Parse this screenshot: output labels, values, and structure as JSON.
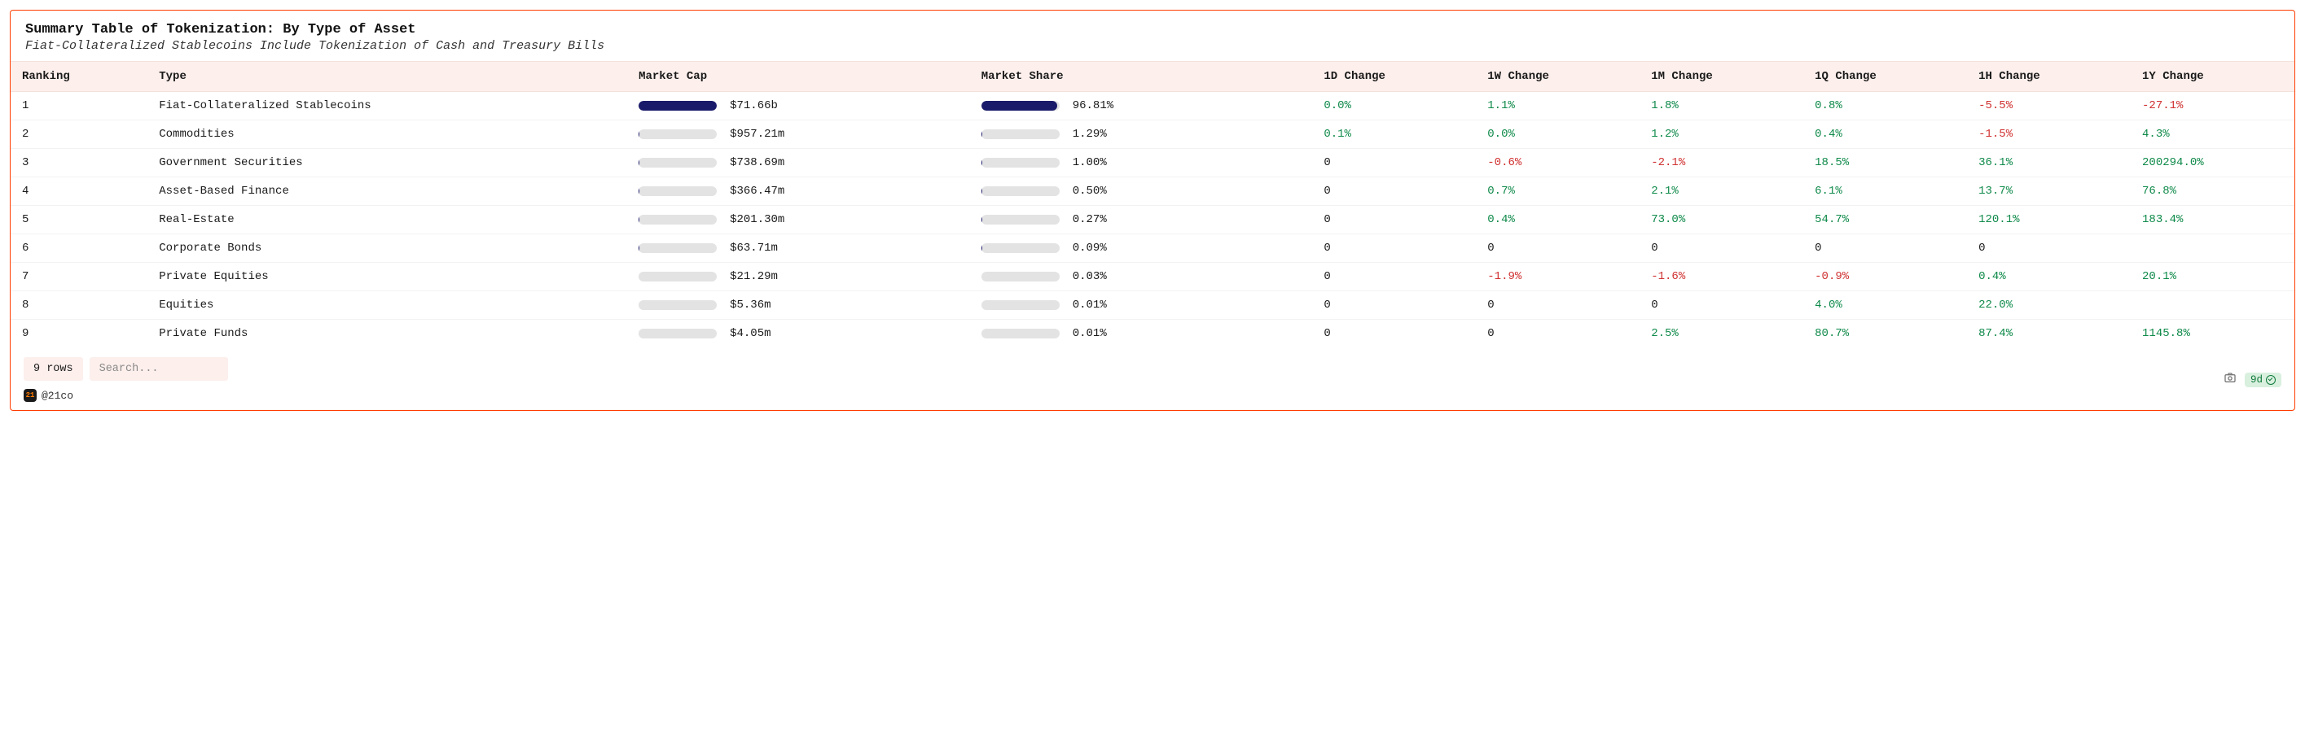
{
  "header": {
    "title": "Summary Table of Tokenization: By Type of Asset",
    "subtitle": "Fiat-Collateralized Stablecoins Include Tokenization of Cash and Treasury Bills"
  },
  "columns": {
    "ranking": "Ranking",
    "type": "Type",
    "market_cap": "Market Cap",
    "market_share": "Market Share",
    "d1": "1D Change",
    "w1": "1W Change",
    "m1": "1M Change",
    "q1": "1Q Change",
    "h1": "1H Change",
    "y1": "1Y Change"
  },
  "rows": [
    {
      "rank": "1",
      "type": "Fiat-Collateralized Stablecoins",
      "mcap": "$71.66b",
      "mcap_pct": 100,
      "mshare": "96.81%",
      "mshare_pct": 96.81,
      "d1": {
        "v": "0.0%",
        "c": "pos"
      },
      "w1": {
        "v": "1.1%",
        "c": "pos"
      },
      "m1": {
        "v": "1.8%",
        "c": "pos"
      },
      "q1": {
        "v": "0.8%",
        "c": "pos"
      },
      "h1": {
        "v": "-5.5%",
        "c": "neg"
      },
      "y1": {
        "v": "-27.1%",
        "c": "neg"
      }
    },
    {
      "rank": "2",
      "type": "Commodities",
      "mcap": "$957.21m",
      "mcap_pct": 1.34,
      "mshare": "1.29%",
      "mshare_pct": 1.29,
      "d1": {
        "v": "0.1%",
        "c": "pos"
      },
      "w1": {
        "v": "0.0%",
        "c": "pos"
      },
      "m1": {
        "v": "1.2%",
        "c": "pos"
      },
      "q1": {
        "v": "0.4%",
        "c": "pos"
      },
      "h1": {
        "v": "-1.5%",
        "c": "neg"
      },
      "y1": {
        "v": "4.3%",
        "c": "pos"
      }
    },
    {
      "rank": "3",
      "type": "Government Securities",
      "mcap": "$738.69m",
      "mcap_pct": 1.03,
      "mshare": "1.00%",
      "mshare_pct": 1.0,
      "d1": {
        "v": "0",
        "c": ""
      },
      "w1": {
        "v": "-0.6%",
        "c": "neg"
      },
      "m1": {
        "v": "-2.1%",
        "c": "neg"
      },
      "q1": {
        "v": "18.5%",
        "c": "pos"
      },
      "h1": {
        "v": "36.1%",
        "c": "pos"
      },
      "y1": {
        "v": "200294.0%",
        "c": "pos"
      }
    },
    {
      "rank": "4",
      "type": "Asset-Based Finance",
      "mcap": "$366.47m",
      "mcap_pct": 0.51,
      "mshare": "0.50%",
      "mshare_pct": 0.5,
      "d1": {
        "v": "0",
        "c": ""
      },
      "w1": {
        "v": "0.7%",
        "c": "pos"
      },
      "m1": {
        "v": "2.1%",
        "c": "pos"
      },
      "q1": {
        "v": "6.1%",
        "c": "pos"
      },
      "h1": {
        "v": "13.7%",
        "c": "pos"
      },
      "y1": {
        "v": "76.8%",
        "c": "pos"
      }
    },
    {
      "rank": "5",
      "type": "Real-Estate",
      "mcap": "$201.30m",
      "mcap_pct": 0.28,
      "mshare": "0.27%",
      "mshare_pct": 0.27,
      "d1": {
        "v": "0",
        "c": ""
      },
      "w1": {
        "v": "0.4%",
        "c": "pos"
      },
      "m1": {
        "v": "73.0%",
        "c": "pos"
      },
      "q1": {
        "v": "54.7%",
        "c": "pos"
      },
      "h1": {
        "v": "120.1%",
        "c": "pos"
      },
      "y1": {
        "v": "183.4%",
        "c": "pos"
      }
    },
    {
      "rank": "6",
      "type": "Corporate Bonds",
      "mcap": "$63.71m",
      "mcap_pct": 0.09,
      "mshare": "0.09%",
      "mshare_pct": 0.09,
      "d1": {
        "v": "0",
        "c": ""
      },
      "w1": {
        "v": "0",
        "c": ""
      },
      "m1": {
        "v": "0",
        "c": ""
      },
      "q1": {
        "v": "0",
        "c": ""
      },
      "h1": {
        "v": "0",
        "c": ""
      },
      "y1": {
        "v": "",
        "c": ""
      }
    },
    {
      "rank": "7",
      "type": "Private Equities",
      "mcap": "$21.29m",
      "mcap_pct": 0.03,
      "mshare": "0.03%",
      "mshare_pct": 0.03,
      "d1": {
        "v": "0",
        "c": ""
      },
      "w1": {
        "v": "-1.9%",
        "c": "neg"
      },
      "m1": {
        "v": "-1.6%",
        "c": "neg"
      },
      "q1": {
        "v": "-0.9%",
        "c": "neg"
      },
      "h1": {
        "v": "0.4%",
        "c": "pos"
      },
      "y1": {
        "v": "20.1%",
        "c": "pos"
      }
    },
    {
      "rank": "8",
      "type": "Equities",
      "mcap": "$5.36m",
      "mcap_pct": 0.01,
      "mshare": "0.01%",
      "mshare_pct": 0.01,
      "d1": {
        "v": "0",
        "c": ""
      },
      "w1": {
        "v": "0",
        "c": ""
      },
      "m1": {
        "v": "0",
        "c": ""
      },
      "q1": {
        "v": "4.0%",
        "c": "pos"
      },
      "h1": {
        "v": "22.0%",
        "c": "pos"
      },
      "y1": {
        "v": "",
        "c": ""
      }
    },
    {
      "rank": "9",
      "type": "Private Funds",
      "mcap": "$4.05m",
      "mcap_pct": 0.01,
      "mshare": "0.01%",
      "mshare_pct": 0.01,
      "d1": {
        "v": "0",
        "c": ""
      },
      "w1": {
        "v": "0",
        "c": ""
      },
      "m1": {
        "v": "2.5%",
        "c": "pos"
      },
      "q1": {
        "v": "80.7%",
        "c": "pos"
      },
      "h1": {
        "v": "87.4%",
        "c": "pos"
      },
      "y1": {
        "v": "1145.8%",
        "c": "pos"
      }
    }
  ],
  "footer": {
    "row_count": "9 rows",
    "search_placeholder": "Search...",
    "attribution": "@21co",
    "age_badge": "9d"
  },
  "chart_data": {
    "type": "table",
    "title": "Summary Table of Tokenization: By Type of Asset",
    "columns": [
      "Ranking",
      "Type",
      "Market Cap",
      "Market Share",
      "1D Change",
      "1W Change",
      "1M Change",
      "1Q Change",
      "1H Change",
      "1Y Change"
    ],
    "series": [
      {
        "name": "Market Share (%)",
        "categories": [
          "Fiat-Collateralized Stablecoins",
          "Commodities",
          "Government Securities",
          "Asset-Based Finance",
          "Real-Estate",
          "Corporate Bonds",
          "Private Equities",
          "Equities",
          "Private Funds"
        ],
        "values": [
          96.81,
          1.29,
          1.0,
          0.5,
          0.27,
          0.09,
          0.03,
          0.01,
          0.01
        ]
      },
      {
        "name": "Market Cap (USD millions)",
        "categories": [
          "Fiat-Collateralized Stablecoins",
          "Commodities",
          "Government Securities",
          "Asset-Based Finance",
          "Real-Estate",
          "Corporate Bonds",
          "Private Equities",
          "Equities",
          "Private Funds"
        ],
        "values": [
          71660,
          957.21,
          738.69,
          366.47,
          201.3,
          63.71,
          21.29,
          5.36,
          4.05
        ]
      }
    ]
  }
}
